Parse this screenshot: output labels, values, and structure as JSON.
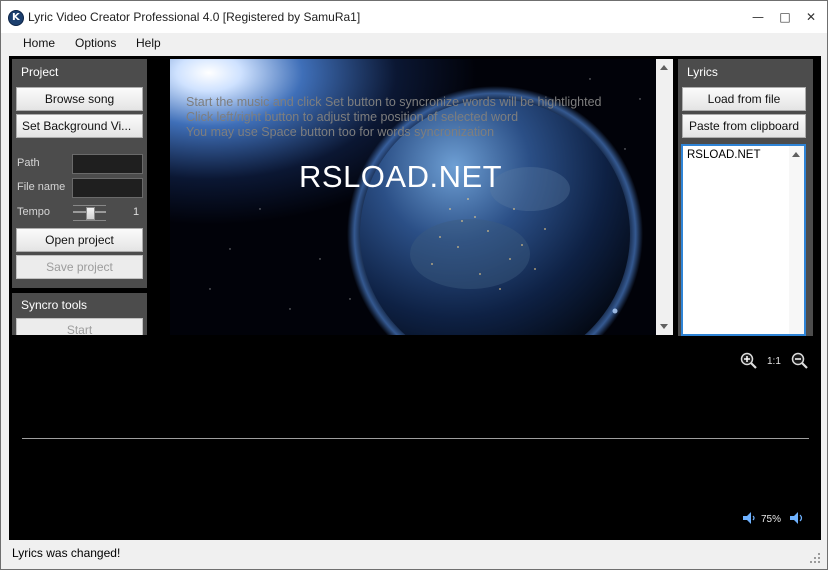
{
  "window": {
    "title": "Lyric Video Creator Professional 4.0 [Registered by SamuRa1]",
    "minimize_icon": "minimize-icon",
    "maximize_icon": "maximize-icon",
    "close_icon": "close-icon"
  },
  "menu": {
    "items": [
      "Home",
      "Options",
      "Help"
    ]
  },
  "project_panel": {
    "title": "Project",
    "browse_song": "Browse song",
    "set_background": "Set  Background Vi...",
    "path_label": "Path",
    "path_value": "",
    "filename_label": "File name",
    "filename_value": "",
    "tempo_label": "Tempo",
    "tempo_value": "1",
    "open_project": "Open project",
    "save_project": "Save project"
  },
  "syncro_panel": {
    "title": "Syncro tools",
    "start": "Start"
  },
  "preview": {
    "hint_lines": [
      "Start the music and click Set button to syncronize words will be hightlighted",
      "Click left/right button to adjust time position of selected word",
      "You may use Space button too for words syncronization"
    ],
    "watermark": "RSLOAD.NET"
  },
  "lyrics_panel": {
    "title": "Lyrics",
    "load_from_file": "Load from file",
    "paste_from_clipboard": "Paste from clipboard",
    "text": "RSLOAD.NET"
  },
  "timeline": {
    "zoom_ratio": "1:1",
    "volume": "75%",
    "icons": [
      "zoom-in-icon",
      "zoom-out-icon",
      "volume-down-icon",
      "volume-up-icon"
    ]
  },
  "status": {
    "text": "Lyrics was changed!"
  },
  "colors": {
    "panel": "#4c4c4c",
    "accent": "#2f84d6",
    "background": "#000000"
  }
}
